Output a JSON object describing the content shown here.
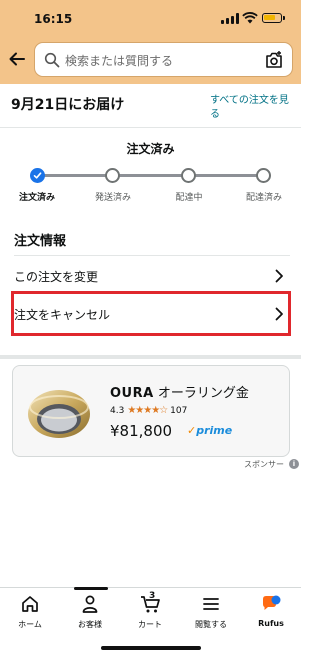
{
  "status_bar": {
    "time": "16:15"
  },
  "search": {
    "placeholder": "検索または質問する"
  },
  "delivery": {
    "date_text": "9月21日にお届け",
    "all_orders_link": "すべての注文を見る"
  },
  "progress": {
    "title": "注文済み",
    "steps": [
      {
        "label": "注文済み",
        "active": true
      },
      {
        "label": "発送済み",
        "active": false
      },
      {
        "label": "配達中",
        "active": false
      },
      {
        "label": "配達済み",
        "active": false
      }
    ]
  },
  "order_info": {
    "heading": "注文情報",
    "rows": [
      {
        "label": "この注文を変更"
      },
      {
        "label": "注文をキャンセル"
      }
    ]
  },
  "ad": {
    "brand": "OURA",
    "product": "オーラリング金",
    "rating": "4.3",
    "review_count": "107",
    "stars": 4.3,
    "price": "¥81,800",
    "prime": "prime",
    "sponsored": "スポンサー",
    "info_glyph": "i"
  },
  "bottom_nav": {
    "items": [
      {
        "label": "ホーム",
        "icon": "home-icon"
      },
      {
        "label": "お客様",
        "icon": "account-icon"
      },
      {
        "label": "カート",
        "icon": "cart-icon",
        "badge": "3"
      },
      {
        "label": "閲覧する",
        "icon": "menu-icon"
      },
      {
        "label": "Rufus",
        "icon": "rufus-icon"
      }
    ]
  },
  "colors": {
    "header_bg": "#f3c48a",
    "accent_blue": "#1a73e8",
    "highlight_red": "#e0282d",
    "link": "#007185"
  }
}
